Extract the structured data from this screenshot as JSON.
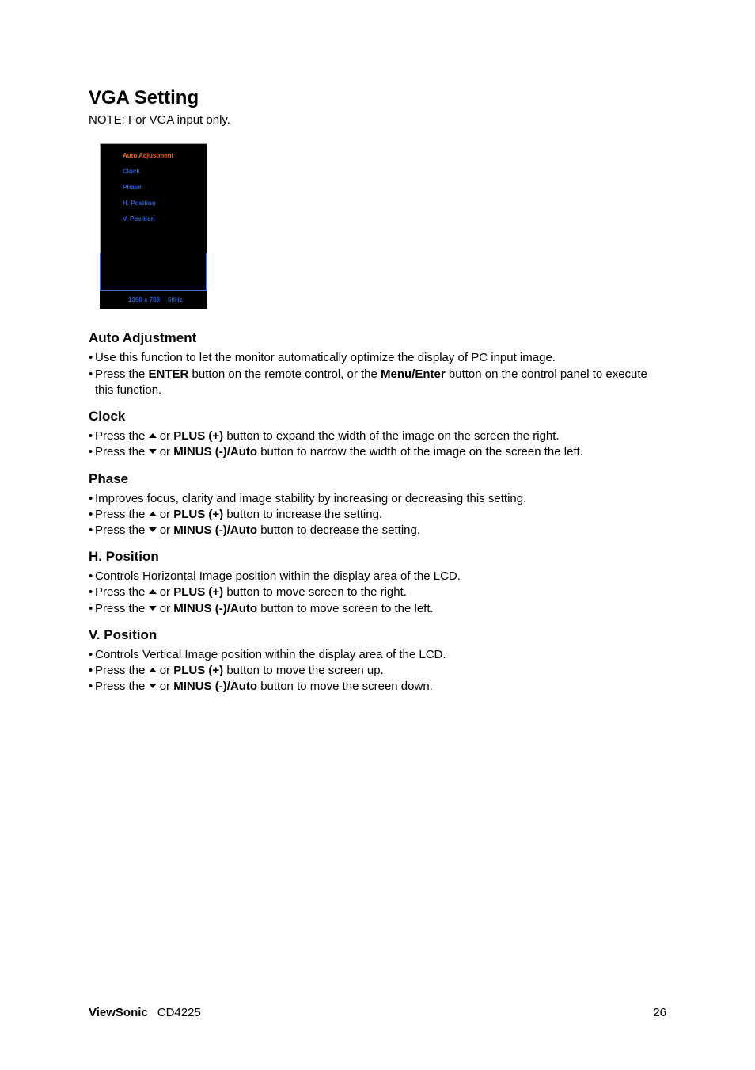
{
  "title": "VGA Setting",
  "note": "NOTE: For VGA input only.",
  "osd": {
    "items": [
      "Auto Adjustment",
      "Clock",
      "Phase",
      "H. Position",
      "V. Position"
    ],
    "res": "1360 x 768",
    "hz": "60Hz"
  },
  "sections": [
    {
      "heading": "Auto Adjustment",
      "bullets": [
        {
          "parts": [
            "Use this function to let the monitor automatically optimize the display of PC input image."
          ]
        },
        {
          "parts": [
            "Press the ",
            {
              "b": "ENTER"
            },
            " button on the remote control, or the ",
            {
              "b": "Menu/Enter"
            },
            " button on the control panel to execute this function."
          ]
        }
      ]
    },
    {
      "heading": "Clock",
      "bullets": [
        {
          "parts": [
            "Press the ",
            {
              "tri": "up"
            },
            " or ",
            {
              "b": "PLUS (+)"
            },
            " button to expand the width of the image on the screen the right."
          ]
        },
        {
          "parts": [
            "Press the ",
            {
              "tri": "down"
            },
            " or ",
            {
              "b": "MINUS (-)/Auto"
            },
            " button to narrow the width of the image on the screen the left."
          ]
        }
      ]
    },
    {
      "heading": "Phase",
      "bullets": [
        {
          "parts": [
            "Improves focus, clarity and image stability by increasing or decreasing this setting."
          ]
        },
        {
          "parts": [
            "Press the ",
            {
              "tri": "up"
            },
            " or ",
            {
              "b": "PLUS (+)"
            },
            " button to increase the setting."
          ]
        },
        {
          "parts": [
            "Press the ",
            {
              "tri": "down"
            },
            " or ",
            {
              "b": "MINUS (-)/Auto"
            },
            " button to decrease the setting."
          ]
        }
      ]
    },
    {
      "heading": "H. Position",
      "bullets": [
        {
          "parts": [
            "Controls Horizontal Image position within the display area of the LCD."
          ]
        },
        {
          "parts": [
            "Press the ",
            {
              "tri": "up"
            },
            " or ",
            {
              "b": "PLUS (+)"
            },
            " button to move screen to the right."
          ]
        },
        {
          "parts": [
            "Press the ",
            {
              "tri": "down"
            },
            " or ",
            {
              "b": "MINUS (-)/Auto"
            },
            " button to move screen to the left."
          ]
        }
      ]
    },
    {
      "heading": "V. Position",
      "bullets": [
        {
          "parts": [
            "Controls Vertical Image position within the display area of the LCD."
          ]
        },
        {
          "parts": [
            "Press the ",
            {
              "tri": "up"
            },
            " or ",
            {
              "b": "PLUS (+)"
            },
            " button to move the screen up."
          ]
        },
        {
          "parts": [
            "Press the ",
            {
              "tri": "down"
            },
            " or ",
            {
              "b": "MINUS (-)/Auto"
            },
            " button to move the screen down."
          ]
        }
      ]
    }
  ],
  "footer": {
    "brand": "ViewSonic",
    "model": "CD4225",
    "page": "26"
  }
}
